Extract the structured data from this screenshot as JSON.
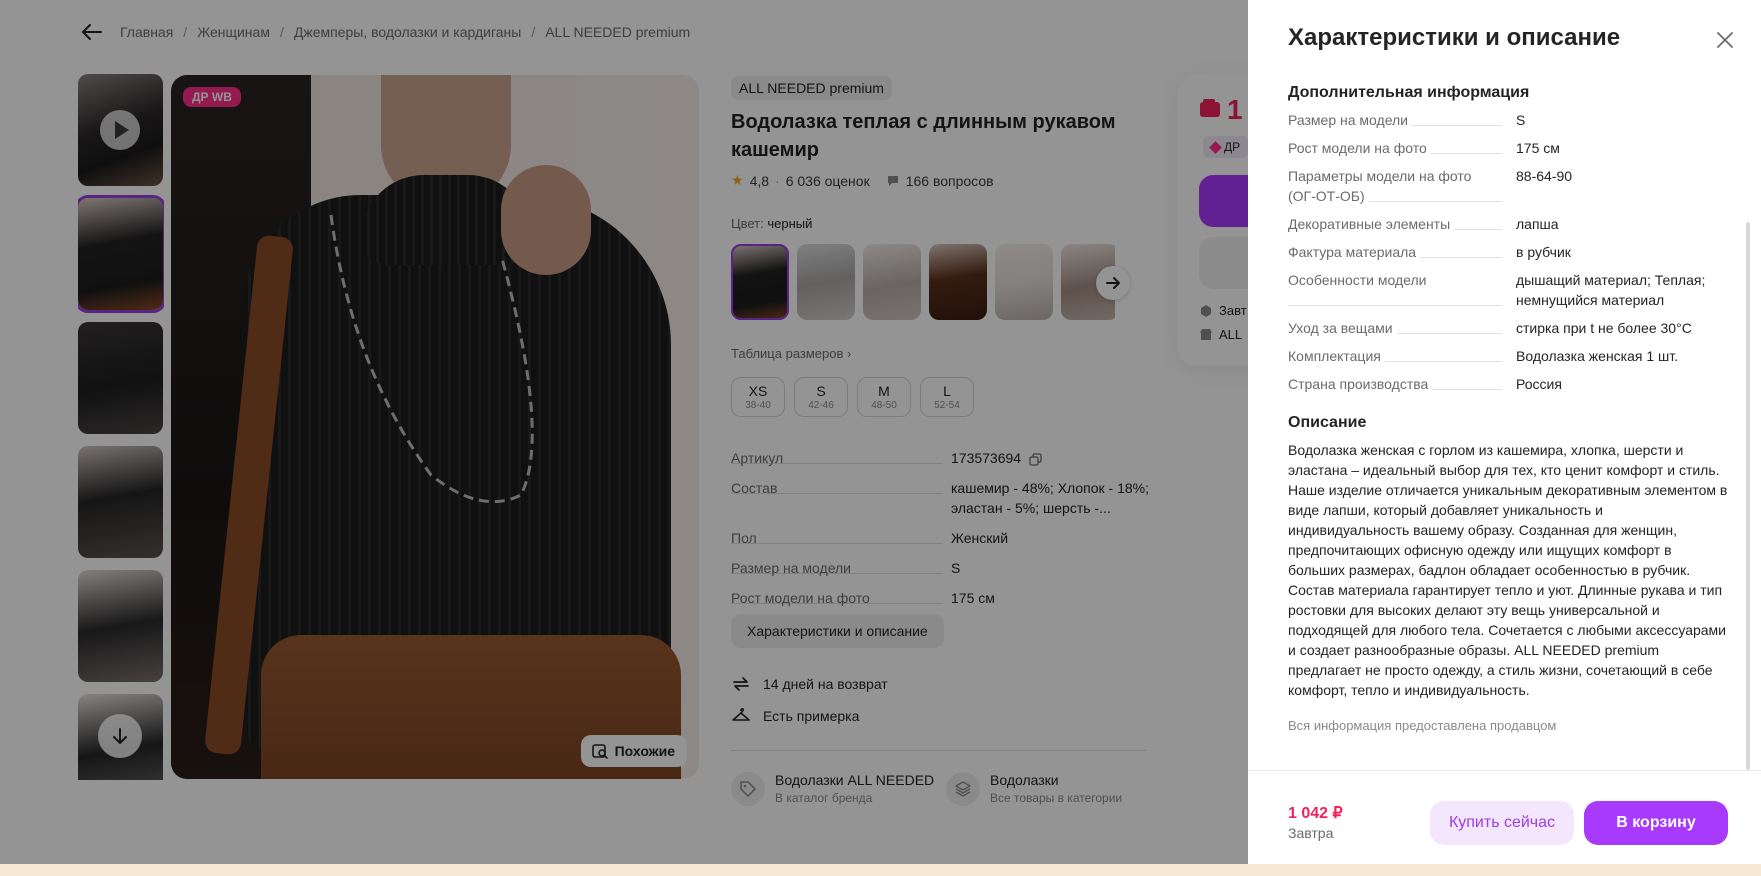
{
  "breadcrumb": {
    "items": [
      "Главная",
      "Женщинам",
      "Джемперы, водолазки и кардиганы",
      "ALL NEEDED premium"
    ],
    "separator": "/"
  },
  "gallery": {
    "badge": "ДР WB",
    "similar_label": "Похожие"
  },
  "product": {
    "brand": "ALL NEEDED premium",
    "title": "Водолазка теплая с длинным рукавом кашемир",
    "rating": "4,8",
    "reviews": "6 036 оценок",
    "questions": "166 вопросов",
    "color_label": "Цвет:",
    "color_value": "черный",
    "size_table_link": "Таблица размеров",
    "sizes": [
      {
        "name": "XS",
        "range": "38-40"
      },
      {
        "name": "S",
        "range": "42-46"
      },
      {
        "name": "M",
        "range": "48-50"
      },
      {
        "name": "L",
        "range": "52-54"
      }
    ],
    "specs": [
      {
        "key": "Артикул",
        "value": "173573694"
      },
      {
        "key": "Состав",
        "value": "кашемир - 48%; Хлопок - 18%; эластан - 5%; шерсть -..."
      },
      {
        "key": "Пол",
        "value": "Женский"
      },
      {
        "key": "Размер на модели",
        "value": "S"
      },
      {
        "key": "Рост модели на фото",
        "value": "175 см"
      }
    ],
    "chars_button": "Характеристики и описание",
    "perks": [
      "14 дней на возврат",
      "Есть примерка"
    ],
    "links": [
      {
        "title": "Водолазки ALL NEEDED",
        "subtitle": "В каталог бренда"
      },
      {
        "title": "Водолазки",
        "subtitle": "Все товары в категории"
      }
    ]
  },
  "price_card": {
    "price_partial": "1",
    "dr_partial": "ДР",
    "line1": "Завт",
    "line2": "ALL"
  },
  "panel": {
    "title": "Характеристики и описание",
    "extra_title": "Дополнительная информация",
    "extra": [
      {
        "key": "Размер на модели",
        "value": "S"
      },
      {
        "key": "Рост модели на фото",
        "value": "175 см"
      },
      {
        "key": "Параметры модели на фото (ОГ-ОТ-ОБ)",
        "value": "88-64-90"
      },
      {
        "key": "Декоративные элементы",
        "value": "лапша"
      },
      {
        "key": "Фактура материала",
        "value": "в рубчик"
      },
      {
        "key": "Особенности модели",
        "value": "дышащий материал; Теплая; немнущийся материал"
      },
      {
        "key": "Уход за вещами",
        "value": "стирка при t не более 30°C"
      },
      {
        "key": "Комплектация",
        "value": "Водолазка женская 1 шт."
      },
      {
        "key": "Страна производства",
        "value": "Россия"
      }
    ],
    "description_title": "Описание",
    "description": "Водолазка женская с горлом из кашемира, хлопка, шерсти и эластана – идеальный выбор для тех, кто ценит комфорт и стиль. Наше изделие отличается уникальным декоративным элементом в виде лапши, который добавляет уникальность и индивидуальность вашему образу. Созданная для женщин, предпочитающих офисную одежду или ищущих комфорт в больших размерах, бадлон обладает особенностью в рубчик. Состав материала гарантирует тепло и уют. Длинные рукава и тип ростовки для высоких делают эту вещь универсальной и подходящей для любого тела. Сочетается с любыми аксессуарами и создает разнообразные образы. ALL NEEDED premium предлагает не просто одежду, а стиль жизни, сочетающий в себе комфорт, тепло и индивидуальность.",
    "seller_note": "Вся информация предоставлена продавцом",
    "footer": {
      "price": "1 042 ₽",
      "delivery": "Завтра",
      "buy_now": "Купить сейчас",
      "add_to_cart": "В корзину"
    }
  },
  "colors": {
    "accent": "#a73afd",
    "price": "#f0245a",
    "badge": "#ff2e8b"
  }
}
